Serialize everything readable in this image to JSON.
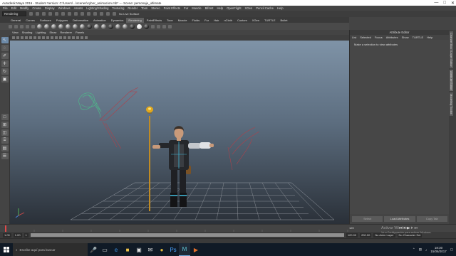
{
  "window": {
    "title": "Autodesk Maya 2016 - Student Version: C:\\Users\\...\\scenes\\cyber_animacion.mb* --- Scene: personaje_ultimate",
    "min": "—",
    "max": "□",
    "close": "✕"
  },
  "menubar": [
    "File",
    "Edit",
    "Modify",
    "Create",
    "Display",
    "Windows",
    "Assets",
    "Lighting/Shading",
    "Texturing",
    "Render",
    "Toon",
    "Stereo",
    "Paint Effects",
    "Fur",
    "Muscle",
    "Bifrost",
    "Help",
    "OpenFlight",
    "XGen",
    "Pencil Cache",
    "Help"
  ],
  "statusline": {
    "mode": "Rendering",
    "live_label": "No Live Surface"
  },
  "shelf_tabs": [
    "General",
    "Curves",
    "Surfaces",
    "Polygons",
    "Deformation",
    "Animation",
    "Dynamics",
    "Rendering",
    "PaintEffects",
    "Toon",
    "Muscle",
    "Fluids",
    "Fur",
    "Hair",
    "nCloth",
    "Custom",
    "XGen",
    "TURTLE",
    "Bullet"
  ],
  "active_shelf_tab": "Rendering",
  "viewport": {
    "menu": [
      "View",
      "Shading",
      "Lighting",
      "Show",
      "Renderer",
      "Panels"
    ]
  },
  "attribute_editor": {
    "title": "Attribute Editor",
    "menu": [
      "List",
      "Selected",
      "Focus",
      "Attributes",
      "Show",
      "TURTLE",
      "Help"
    ],
    "message": "Make a selection to view attributes",
    "buttons": [
      "Select",
      "Load Attributes",
      "Copy Tab"
    ]
  },
  "side_tabs": [
    "Channel Box / Layer Editor",
    "Attribute Editor",
    "Modeling Toolkit"
  ],
  "range": {
    "start": "1.00",
    "current": "1.00",
    "frame_label": "1",
    "end_marker": "120",
    "anim_end": "120.00",
    "range_end": "200.00",
    "anim_layer": "No Anim Layer",
    "char_set": "No Character Set"
  },
  "activate_windows": {
    "title": "Activar Windows",
    "subtitle": "Ve a Configuración para activar Windows."
  },
  "taskbar": {
    "search_placeholder": "Escribe aquí para buscar",
    "time": "18:30",
    "date": "15/06/2017"
  }
}
